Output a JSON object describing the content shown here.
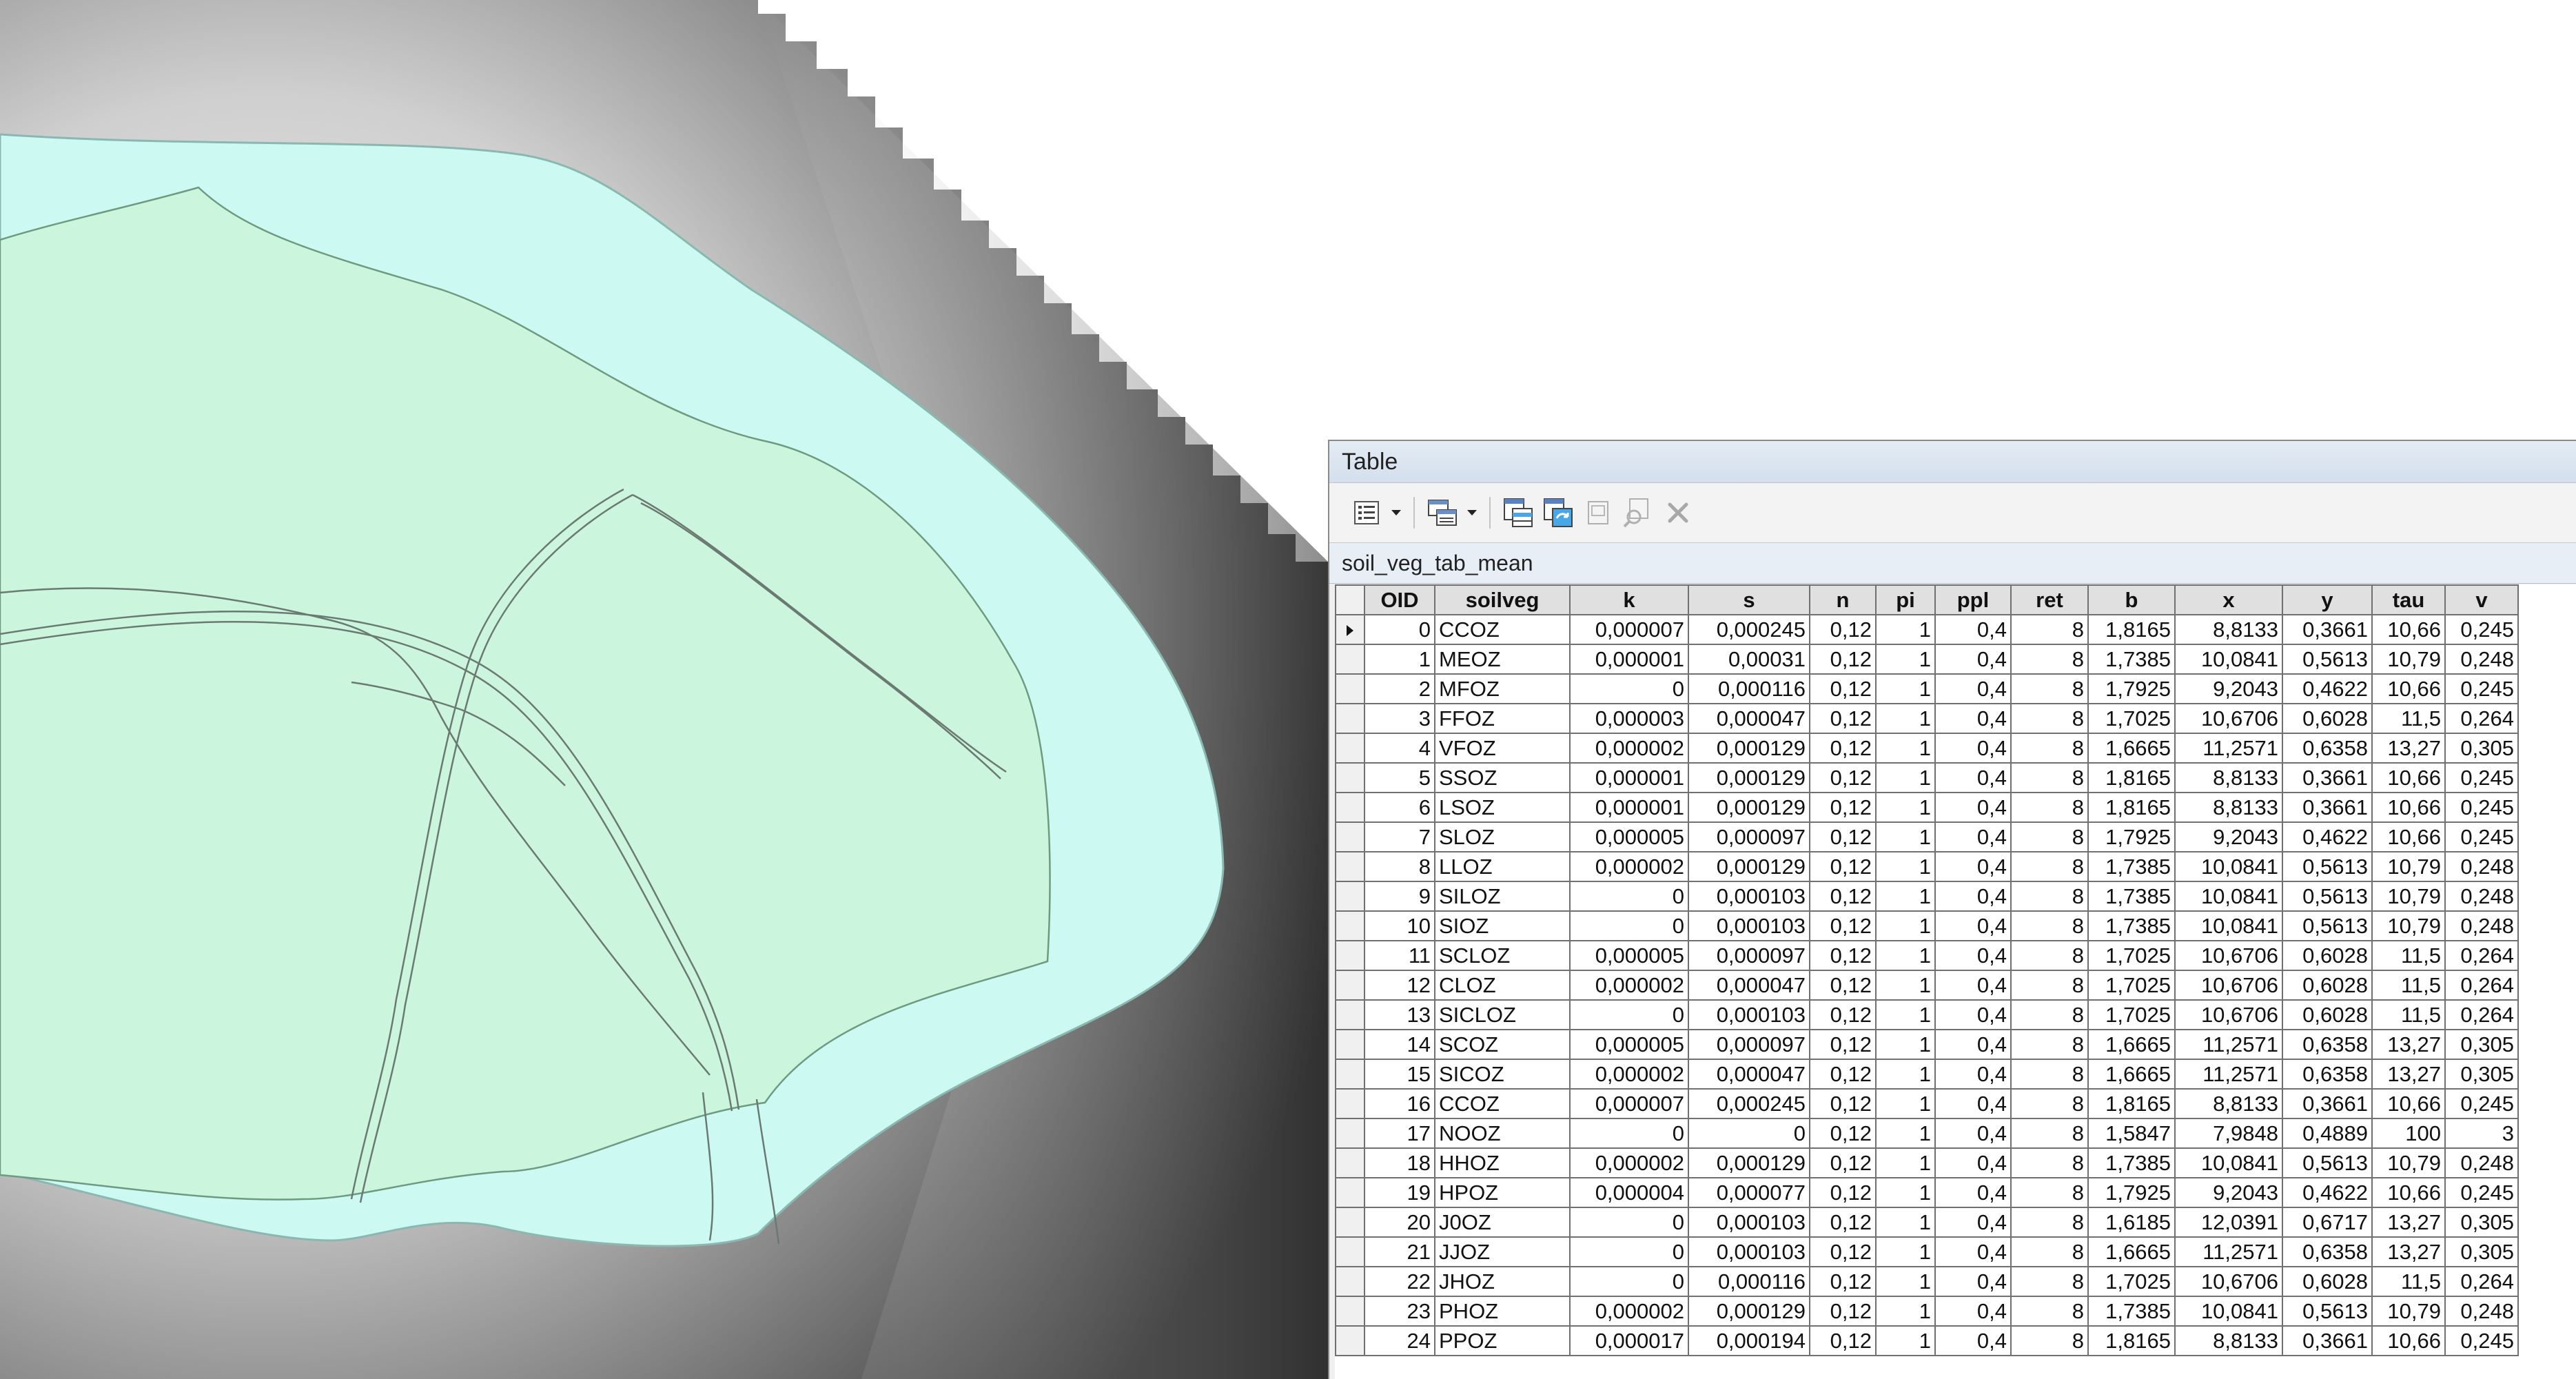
{
  "window": {
    "title": "Table"
  },
  "toolbar": {
    "buttons": [
      {
        "icon": "table-options-icon",
        "dropdown": true
      },
      {
        "icon": "related-tables-icon",
        "dropdown": true
      },
      {
        "icon": "select-by-attributes-icon"
      },
      {
        "icon": "switch-selection-icon"
      },
      {
        "icon": "clear-selection-icon"
      },
      {
        "icon": "zoom-to-selected-icon"
      },
      {
        "icon": "delete-selected-icon"
      }
    ]
  },
  "tab": {
    "name": "soil_veg_tab_mean"
  },
  "table": {
    "columns": [
      "OID",
      "soilveg",
      "k",
      "s",
      "n",
      "pi",
      "ppl",
      "ret",
      "b",
      "x",
      "y",
      "tau",
      "v"
    ],
    "rows": [
      [
        "0",
        "CCOZ",
        "0,000007",
        "0,000245",
        "0,12",
        "1",
        "0,4",
        "8",
        "1,8165",
        "8,8133",
        "0,3661",
        "10,66",
        "0,245"
      ],
      [
        "1",
        "MEOZ",
        "0,000001",
        "0,00031",
        "0,12",
        "1",
        "0,4",
        "8",
        "1,7385",
        "10,0841",
        "0,5613",
        "10,79",
        "0,248"
      ],
      [
        "2",
        "MFOZ",
        "0",
        "0,000116",
        "0,12",
        "1",
        "0,4",
        "8",
        "1,7925",
        "9,2043",
        "0,4622",
        "10,66",
        "0,245"
      ],
      [
        "3",
        "FFOZ",
        "0,000003",
        "0,000047",
        "0,12",
        "1",
        "0,4",
        "8",
        "1,7025",
        "10,6706",
        "0,6028",
        "11,5",
        "0,264"
      ],
      [
        "4",
        "VFOZ",
        "0,000002",
        "0,000129",
        "0,12",
        "1",
        "0,4",
        "8",
        "1,6665",
        "11,2571",
        "0,6358",
        "13,27",
        "0,305"
      ],
      [
        "5",
        "SSOZ",
        "0,000001",
        "0,000129",
        "0,12",
        "1",
        "0,4",
        "8",
        "1,8165",
        "8,8133",
        "0,3661",
        "10,66",
        "0,245"
      ],
      [
        "6",
        "LSOZ",
        "0,000001",
        "0,000129",
        "0,12",
        "1",
        "0,4",
        "8",
        "1,8165",
        "8,8133",
        "0,3661",
        "10,66",
        "0,245"
      ],
      [
        "7",
        "SLOZ",
        "0,000005",
        "0,000097",
        "0,12",
        "1",
        "0,4",
        "8",
        "1,7925",
        "9,2043",
        "0,4622",
        "10,66",
        "0,245"
      ],
      [
        "8",
        "LLOZ",
        "0,000002",
        "0,000129",
        "0,12",
        "1",
        "0,4",
        "8",
        "1,7385",
        "10,0841",
        "0,5613",
        "10,79",
        "0,248"
      ],
      [
        "9",
        "SILOZ",
        "0",
        "0,000103",
        "0,12",
        "1",
        "0,4",
        "8",
        "1,7385",
        "10,0841",
        "0,5613",
        "10,79",
        "0,248"
      ],
      [
        "10",
        "SIOZ",
        "0",
        "0,000103",
        "0,12",
        "1",
        "0,4",
        "8",
        "1,7385",
        "10,0841",
        "0,5613",
        "10,79",
        "0,248"
      ],
      [
        "11",
        "SCLOZ",
        "0,000005",
        "0,000097",
        "0,12",
        "1",
        "0,4",
        "8",
        "1,7025",
        "10,6706",
        "0,6028",
        "11,5",
        "0,264"
      ],
      [
        "12",
        "CLOZ",
        "0,000002",
        "0,000047",
        "0,12",
        "1",
        "0,4",
        "8",
        "1,7025",
        "10,6706",
        "0,6028",
        "11,5",
        "0,264"
      ],
      [
        "13",
        "SICLOZ",
        "0",
        "0,000103",
        "0,12",
        "1",
        "0,4",
        "8",
        "1,7025",
        "10,6706",
        "0,6028",
        "11,5",
        "0,264"
      ],
      [
        "14",
        "SCOZ",
        "0,000005",
        "0,000097",
        "0,12",
        "1",
        "0,4",
        "8",
        "1,6665",
        "11,2571",
        "0,6358",
        "13,27",
        "0,305"
      ],
      [
        "15",
        "SICOZ",
        "0,000002",
        "0,000047",
        "0,12",
        "1",
        "0,4",
        "8",
        "1,6665",
        "11,2571",
        "0,6358",
        "13,27",
        "0,305"
      ],
      [
        "16",
        "CCOZ",
        "0,000007",
        "0,000245",
        "0,12",
        "1",
        "0,4",
        "8",
        "1,8165",
        "8,8133",
        "0,3661",
        "10,66",
        "0,245"
      ],
      [
        "17",
        "NOOZ",
        "0",
        "0",
        "0,12",
        "1",
        "0,4",
        "8",
        "1,5847",
        "7,9848",
        "0,4889",
        "100",
        "3"
      ],
      [
        "18",
        "HHOZ",
        "0,000002",
        "0,000129",
        "0,12",
        "1",
        "0,4",
        "8",
        "1,7385",
        "10,0841",
        "0,5613",
        "10,79",
        "0,248"
      ],
      [
        "19",
        "HPOZ",
        "0,000004",
        "0,000077",
        "0,12",
        "1",
        "0,4",
        "8",
        "1,7925",
        "9,2043",
        "0,4622",
        "10,66",
        "0,245"
      ],
      [
        "20",
        "J0OZ",
        "0",
        "0,000103",
        "0,12",
        "1",
        "0,4",
        "8",
        "1,6185",
        "12,0391",
        "0,6717",
        "13,27",
        "0,305"
      ],
      [
        "21",
        "JJOZ",
        "0",
        "0,000103",
        "0,12",
        "1",
        "0,4",
        "8",
        "1,6665",
        "11,2571",
        "0,6358",
        "13,27",
        "0,305"
      ],
      [
        "22",
        "JHOZ",
        "0",
        "0,000116",
        "0,12",
        "1",
        "0,4",
        "8",
        "1,7025",
        "10,6706",
        "0,6028",
        "11,5",
        "0,264"
      ],
      [
        "23",
        "PHOZ",
        "0,000002",
        "0,000129",
        "0,12",
        "1",
        "0,4",
        "8",
        "1,7385",
        "10,0841",
        "0,5613",
        "10,79",
        "0,248"
      ],
      [
        "24",
        "PPOZ",
        "0,000017",
        "0,000194",
        "0,12",
        "1",
        "0,4",
        "8",
        "1,8165",
        "8,8133",
        "0,3661",
        "10,66",
        "0,245"
      ]
    ],
    "current_row": 0
  }
}
